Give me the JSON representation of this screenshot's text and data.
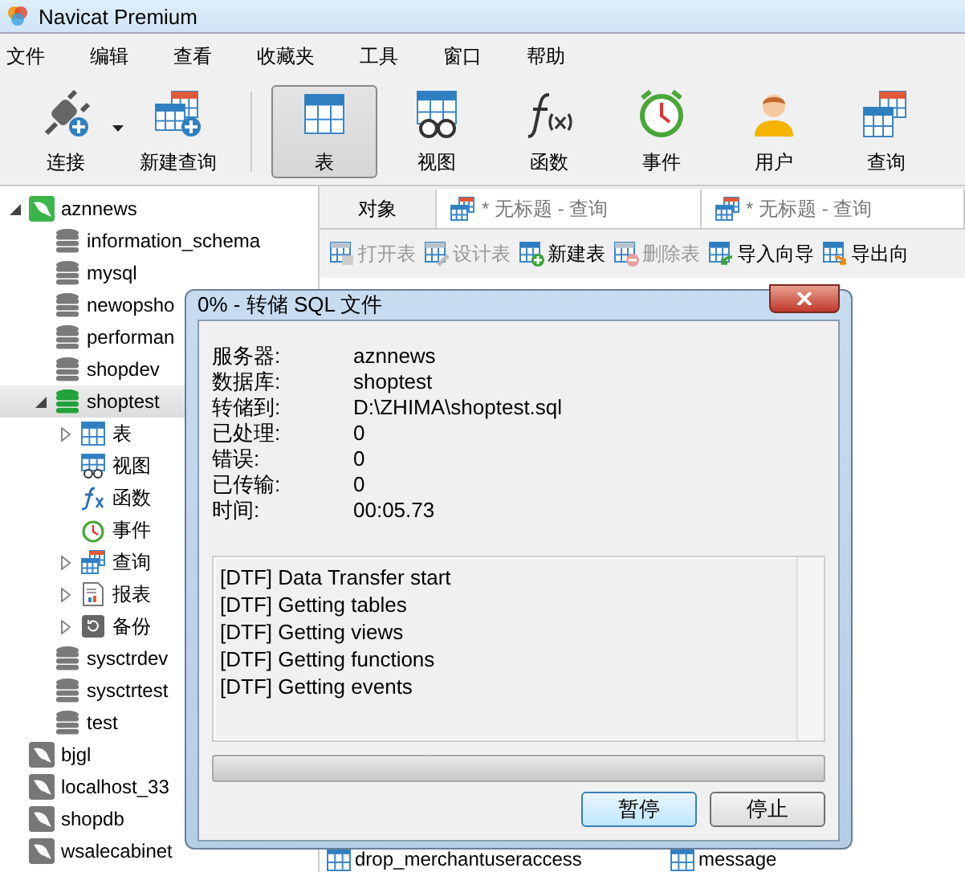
{
  "window": {
    "title": "Navicat Premium"
  },
  "menu": [
    "文件",
    "编辑",
    "查看",
    "收藏夹",
    "工具",
    "窗口",
    "帮助"
  ],
  "toolbar": [
    {
      "kind": "connect",
      "label": "连接",
      "dropdown": true,
      "selected": false
    },
    {
      "kind": "new-query",
      "label": "新建查询",
      "dropdown": false,
      "selected": false
    },
    {
      "kind": "table",
      "label": "表",
      "dropdown": false,
      "selected": true
    },
    {
      "kind": "view",
      "label": "视图",
      "dropdown": false,
      "selected": false
    },
    {
      "kind": "function",
      "label": "函数",
      "dropdown": false,
      "selected": false
    },
    {
      "kind": "event",
      "label": "事件",
      "dropdown": false,
      "selected": false
    },
    {
      "kind": "user",
      "label": "用户",
      "dropdown": false,
      "selected": false
    },
    {
      "kind": "query",
      "label": "查询",
      "dropdown": false,
      "selected": false
    }
  ],
  "tree": [
    {
      "kind": "connection",
      "label": "aznnews",
      "open": true,
      "expanded": true,
      "selected": false,
      "children": [
        {
          "kind": "database",
          "label": "information_schema",
          "open": false,
          "selected": false
        },
        {
          "kind": "database",
          "label": "mysql",
          "open": false,
          "selected": false
        },
        {
          "kind": "database",
          "label": "newopsho",
          "open": false,
          "selected": false
        },
        {
          "kind": "database",
          "label": "performan",
          "open": false,
          "selected": false
        },
        {
          "kind": "database",
          "label": "shopdev",
          "open": false,
          "selected": false
        },
        {
          "kind": "database",
          "label": "shoptest",
          "open": true,
          "expanded": true,
          "selected": true,
          "children": [
            {
              "kind": "table",
              "label": "表",
              "expanded": false,
              "selected": false
            },
            {
              "kind": "view",
              "label": "视图",
              "selected": false
            },
            {
              "kind": "function",
              "label": "函数",
              "selected": false
            },
            {
              "kind": "event",
              "label": "事件",
              "selected": false
            },
            {
              "kind": "query",
              "label": "查询",
              "expanded": false,
              "selected": false
            },
            {
              "kind": "report",
              "label": "报表",
              "expanded": false,
              "selected": false
            },
            {
              "kind": "backup",
              "label": "备份",
              "expanded": false,
              "selected": false
            }
          ]
        },
        {
          "kind": "database",
          "label": "sysctrdev",
          "open": false,
          "selected": false
        },
        {
          "kind": "database",
          "label": "sysctrtest",
          "open": false,
          "selected": false
        },
        {
          "kind": "database",
          "label": "test",
          "open": false,
          "selected": false
        }
      ]
    },
    {
      "kind": "connection",
      "label": "bjgl",
      "open": false,
      "selected": false
    },
    {
      "kind": "connection",
      "label": "localhost_33",
      "open": false,
      "selected": false
    },
    {
      "kind": "connection",
      "label": "shopdb",
      "open": false,
      "selected": false
    },
    {
      "kind": "connection",
      "label": "wsalecabinet",
      "open": false,
      "selected": false
    }
  ],
  "tabs": [
    {
      "kind": "objects",
      "label": "对象",
      "selected": true
    },
    {
      "kind": "query",
      "label": "* 无标题 - 查询",
      "selected": false
    },
    {
      "kind": "query",
      "label": "* 无标题 - 查询",
      "selected": false
    }
  ],
  "object_toolbar": [
    {
      "kind": "open",
      "label": "打开表",
      "disabled": true
    },
    {
      "kind": "design",
      "label": "设计表",
      "disabled": true
    },
    {
      "kind": "new",
      "label": "新建表",
      "disabled": false
    },
    {
      "kind": "delete",
      "label": "删除表",
      "disabled": true
    },
    {
      "kind": "import",
      "label": "导入向导",
      "disabled": false
    },
    {
      "kind": "export",
      "label": "导出向",
      "disabled": false
    }
  ],
  "objects": [
    "drop_merchantuseraccess",
    "message"
  ],
  "dialog": {
    "title": "0% - 转储 SQL 文件",
    "info": [
      {
        "label": "服务器:",
        "value": "aznnews"
      },
      {
        "label": "数据库:",
        "value": "shoptest"
      },
      {
        "label": "转储到:",
        "value": "D:\\ZHIMA\\shoptest.sql"
      },
      {
        "label": "已处理:",
        "value": "0"
      },
      {
        "label": "错误:",
        "value": "0"
      },
      {
        "label": "已传输:",
        "value": "0"
      },
      {
        "label": "时间:",
        "value": "00:05.73"
      }
    ],
    "log": [
      "[DTF] Data Transfer start",
      "[DTF] Getting tables",
      "[DTF] Getting views",
      "[DTF] Getting functions",
      "[DTF] Getting events"
    ],
    "progress": {
      "level": 0
    },
    "buttons": [
      {
        "label": "暂停",
        "default": true
      },
      {
        "label": "停止",
        "default": false
      }
    ]
  }
}
